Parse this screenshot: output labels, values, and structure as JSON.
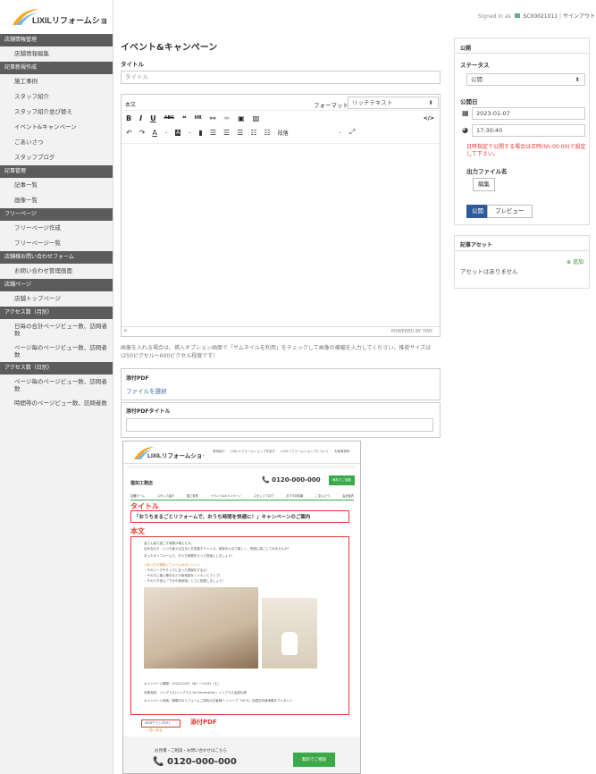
{
  "topbar": {
    "signed_in": "Signed in as",
    "user": "SC00021011",
    "signout": "サインアウト"
  },
  "logo": "LIXILリフォームショップ",
  "sidebar": {
    "s1": "店舗情報管理",
    "s1i": [
      "店舗情報編集"
    ],
    "s2": "記事新規作成",
    "s2i": [
      "施工事例",
      "スタッフ紹介",
      "スタッフ紹介並び替え",
      "イベント&キャンペーン",
      "ごあいさつ",
      "スタッフブログ"
    ],
    "s3": "記事管理",
    "s3i": [
      "記事一覧",
      "画像一覧"
    ],
    "s4": "フリーページ",
    "s4i": [
      "フリーページ作成",
      "フリーページ一覧"
    ],
    "s5": "店舗様お問い合わせフォーム",
    "s5i": [
      "お問い合わせ管理画面"
    ],
    "s6": "店舗ページ",
    "s6i": [
      "店舗トップページ"
    ],
    "s7": "アクセス数（月別）",
    "s7i": [
      "日毎の合計ページビュー数、訪問者数",
      "ページ毎のページビュー数、訪問者数"
    ],
    "s8": "アクセス数（日別）",
    "s8i": [
      "ページ毎のページビュー数、訪問者数",
      "時間帯のページビュー数、訪問者数"
    ]
  },
  "main": {
    "title": "イベント&キャンペーン",
    "title_label": "タイトル",
    "title_placeholder": "タイトル",
    "body_tab": "本文",
    "format_label": "フォーマット",
    "format_value": "リッチテキスト",
    "paragraph": "段落",
    "p_tag": "P",
    "powered": "POWERED BY TINY",
    "note": "画像を入れる場合は、挿入オプション画面で「サムネイルを利用」をチェックして画像の横幅を入力してください。推奨サイズは(250ピクセル〜600ピクセル程度です）",
    "pdf_label": "添付PDF",
    "pdf_select": "ファイルを選択",
    "pdf_title_label": "添付PDFタイトル"
  },
  "right": {
    "publish": "公開",
    "status_label": "ステータス",
    "status_value": "公開",
    "date_label": "公開日",
    "date": "2023-01-07",
    "time": "17:30:40",
    "warning": "日時指定で公開する場合は正時(hh:00:00)で設定して下さい。",
    "output_label": "出力ファイル名",
    "edit_btn": "編集",
    "publish_btn": "公開",
    "preview_btn": "プレビュー",
    "asset_title": "記事アセット",
    "asset_add": "追加",
    "asset_empty": "アセットはありません"
  },
  "preview": {
    "logo": "LIXILリフォームショップ",
    "nav": [
      "事例紹介",
      "LIXILリフォームショップを探す",
      "LIXILリフォームショップについて",
      "お客様事例"
    ],
    "shop": "猫如工務店",
    "phone": "0120-000-000",
    "consult": "無料でご相談",
    "tabs": [
      "店舗ホーム",
      "スタッフ紹介",
      "施工事例",
      "イベント&キャンペーン",
      "スタッフブログ",
      "おすすめ情報",
      "ごあいさつ",
      "会社案内"
    ],
    "title_mark": "タイトル",
    "event_title": "「おうちまるごとリフォームで、おうち時間を快適に！」キャンペーンのご案内",
    "body_mark": "本文",
    "text1": "皆さん家で過ごす時間が増えた今、",
    "text2": "住みなれた、いつも使える住まいを見直すチャンス。家族みんなで楽しく、快適に過ごしてみませんか？",
    "text3": "あったかリフォームで、おうち時間をもっと快適にしましょう！",
    "points_title": "＜あったか家族リフォームのポイント＞",
    "p1": "・そのニーズやサイズに合った提案をするよ！",
    "p2": "・そのちに使い勝手などの使用感をシャキッとアップ！",
    "p3": "・そのうち安心「下げの使用感」とさに配慮しましょう！",
    "period": "キャンペーン期間：2022/12/01（木）〜12/31（土）",
    "target": "対象商品：インプラス/インプラス for Renovation / インプラス浴室仕様",
    "benefit": "キャンペーン特典：期間中のリフォームご成約のお客様へ シャープ「Wi-Fi」加湿空気清浄機をプレゼント",
    "pdf_link": "WEBチラシ(PDF)",
    "pdf_mark": "添付PDF",
    "back": "一覧へ戻る",
    "footer_call": "お見積・ご相談・お問い合わせはこちら",
    "footer_phone": "0120-000-000",
    "footer_btn": "無料でご相談"
  }
}
